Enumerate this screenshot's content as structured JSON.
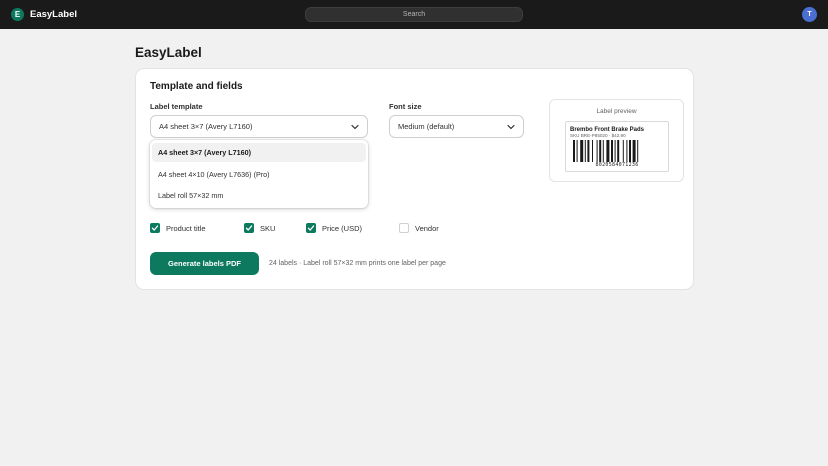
{
  "app": {
    "icon_letter": "E",
    "name": "EasyLabel",
    "avatar_letter": "T"
  },
  "search": {
    "placeholder": "Search"
  },
  "page": {
    "title": "EasyLabel"
  },
  "card": {
    "title": "Template and fields",
    "template": {
      "label": "Label template",
      "value": "A4 sheet 3×7 (Avery L7160)",
      "options": [
        "A4 sheet 3×7 (Avery L7160)",
        "A4 sheet 4×10 (Avery L7636) (Pro)",
        "Label roll 57×32 mm"
      ],
      "selected_index": 0
    },
    "font": {
      "label": "Font size",
      "value": "Medium (default)"
    },
    "preview": {
      "title": "Label preview",
      "product": "Brembo Front Brake Pads",
      "meta": "SKU BRE-P85020 · $42.90",
      "barcode_number": "8020584071236"
    },
    "fields": [
      {
        "label": "Product title",
        "checked": true
      },
      {
        "label": "SKU",
        "checked": true
      },
      {
        "label": "Price (USD)",
        "checked": true
      },
      {
        "label": "Vendor",
        "checked": false
      }
    ],
    "generate_label": "Generate labels PDF",
    "hint": "24 labels · Label roll 57×32 mm prints one label per page"
  },
  "colors": {
    "accent": "#0d7a5f",
    "topbar": "#1a1a1a",
    "avatar": "#4a6ed1",
    "background": "#f1f1f1"
  }
}
